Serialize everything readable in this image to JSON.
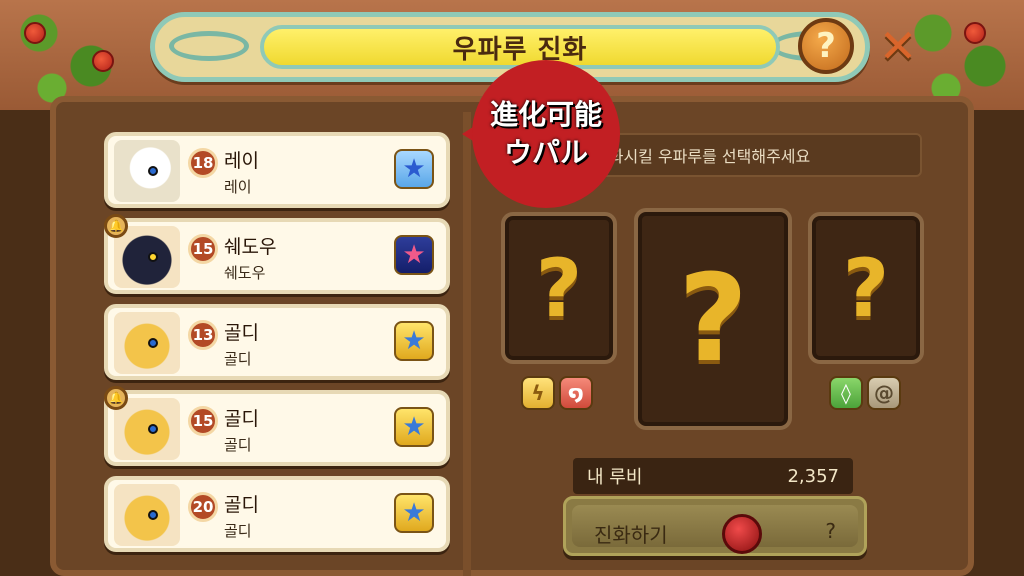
{
  "title": "우파루 진화",
  "header": {
    "help_label": "?",
    "close_label": "✕"
  },
  "callout": {
    "line1": "進化可能",
    "line2": "ウパル"
  },
  "hint": "진화시킬 우파루를 선택해주세요",
  "creatures": [
    {
      "level": "18",
      "name": "레이",
      "species": "레이",
      "locked": false,
      "badge": "blue",
      "portrait": "white"
    },
    {
      "level": "15",
      "name": "쉐도우",
      "species": "쉐도우",
      "locked": true,
      "badge": "navy",
      "portrait": "black"
    },
    {
      "level": "13",
      "name": "골디",
      "species": "골디",
      "locked": false,
      "badge": "gold",
      "portrait": "gold"
    },
    {
      "level": "15",
      "name": "골디",
      "species": "골디",
      "locked": true,
      "badge": "gold",
      "portrait": "gold"
    },
    {
      "level": "20",
      "name": "골디",
      "species": "골디",
      "locked": false,
      "badge": "gold",
      "portrait": "gold"
    }
  ],
  "slots": {
    "left": "?",
    "center": "?",
    "right": "?"
  },
  "elements": {
    "left": [
      "lightning",
      "fire"
    ],
    "right": [
      "leaf",
      "wind"
    ]
  },
  "ruby": {
    "label": "내 루비",
    "value": "2,357"
  },
  "evolve": {
    "label": "진화하기",
    "cost": "?"
  }
}
